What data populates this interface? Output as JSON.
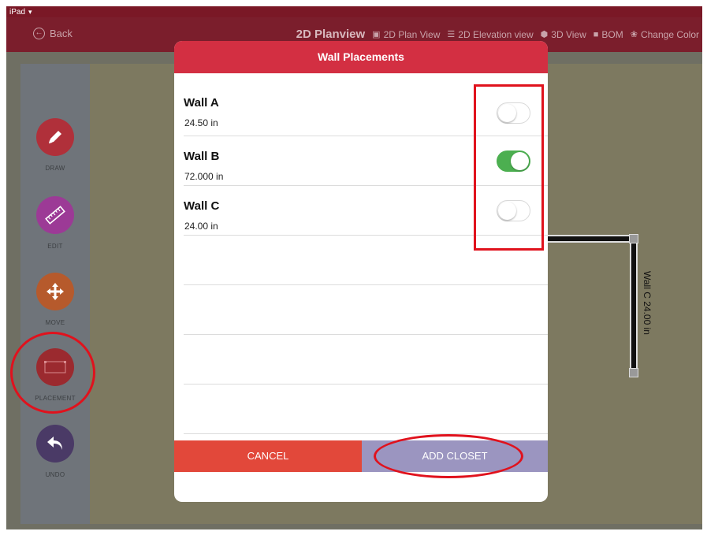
{
  "status_bar": {
    "device": "iPad"
  },
  "header": {
    "back_label": "Back",
    "title": "2D Planview",
    "nav": [
      {
        "label": "2D Plan View",
        "icon": "plan-icon"
      },
      {
        "label": "2D Elevation view",
        "icon": "elevation-icon"
      },
      {
        "label": "3D View",
        "icon": "cube-icon"
      },
      {
        "label": "BOM",
        "icon": "document-icon"
      },
      {
        "label": "Change Color",
        "icon": "palette-icon"
      }
    ]
  },
  "sidebar": {
    "tools": [
      {
        "label": "DRAW",
        "icon": "pencil-icon",
        "color": "#b0303a"
      },
      {
        "label": "EDIT",
        "icon": "ruler-icon",
        "color": "#9c3a96"
      },
      {
        "label": "MOVE",
        "icon": "move-arrows-icon",
        "color": "#b65a2c"
      },
      {
        "label": "PLACEMENT",
        "icon": "placement-rect-icon",
        "color": "#9b2a2f"
      },
      {
        "label": "UNDO",
        "icon": "undo-arrow-icon",
        "color": "#4a3a66"
      }
    ]
  },
  "canvas": {
    "wall_label": "Wall C 24.00 in"
  },
  "modal": {
    "title": "Wall Placements",
    "walls": [
      {
        "name": "Wall A",
        "size": "24.50 in",
        "enabled": false
      },
      {
        "name": "Wall B",
        "size": "72.000 in",
        "enabled": true
      },
      {
        "name": "Wall C",
        "size": "24.00 in",
        "enabled": false
      }
    ],
    "cancel_label": "CANCEL",
    "add_label": "ADD CLOSET"
  },
  "colors": {
    "header_bg": "#7b1e2c",
    "modal_header": "#d32f42",
    "cancel": "#e2483a",
    "add": "#9b95c0",
    "toggle_on": "#4caf50",
    "annotation": "#e0121d"
  }
}
